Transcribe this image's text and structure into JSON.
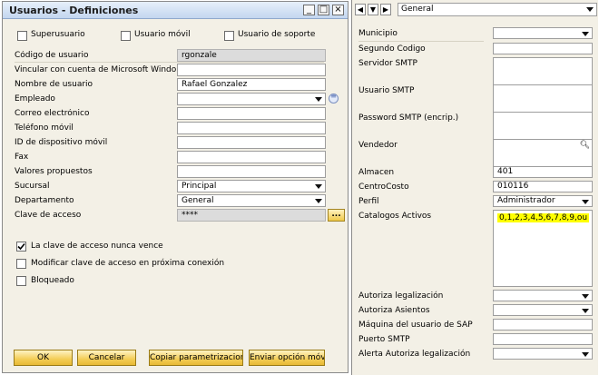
{
  "window": {
    "title": "Usuarios - Definiciones",
    "buttons": {
      "minimize": "_",
      "maximize": "□",
      "close": "×"
    }
  },
  "checkboxes_top": [
    {
      "label": "Superusuario",
      "checked": false
    },
    {
      "label": "Usuario móvil",
      "checked": false
    },
    {
      "label": "Usuario de soporte",
      "checked": false
    }
  ],
  "fields": [
    {
      "label": "Código de usuario",
      "value": "rgonzale",
      "readonly": true
    },
    {
      "label": "Vincular con cuenta de Microsoft Windo",
      "value": ""
    },
    {
      "label": "Nombre de usuario",
      "value": "Rafael Gonzalez"
    },
    {
      "label": "Empleado",
      "value": "",
      "dropdown": true
    },
    {
      "label": "Correo electrónico",
      "value": ""
    },
    {
      "label": "Teléfono móvil",
      "value": ""
    },
    {
      "label": "ID de dispositivo móvil",
      "value": ""
    },
    {
      "label": "Fax",
      "value": ""
    },
    {
      "label": "Valores propuestos",
      "value": ""
    },
    {
      "label": "Sucursal",
      "value": "Principal",
      "dropdown": true
    },
    {
      "label": "Departamento",
      "value": "General",
      "dropdown": true
    },
    {
      "label": "Clave de acceso",
      "value": "****",
      "readonly": true
    }
  ],
  "employee_link_icon": "circle-arrow-icon",
  "password_button": "...",
  "checkboxes_bottom": [
    {
      "label": "La clave de acceso nunca vence",
      "checked": true
    },
    {
      "label": "Modificar clave de acceso en próxima conexión",
      "checked": false
    },
    {
      "label": "Bloqueado",
      "checked": false
    }
  ],
  "buttons": [
    "OK",
    "Cancelar",
    "Copiar parametrizacion",
    "Enviar opción móvil"
  ],
  "right": {
    "nav": {
      "prev": "◀",
      "next": "▼",
      "last": "▶",
      "tab_value": "General"
    },
    "fields": [
      {
        "label": "Municipio",
        "value": "",
        "dropdown": true
      },
      {
        "label": "Segundo Codigo",
        "value": ""
      },
      {
        "label": "Servidor SMTP",
        "value": ""
      },
      {
        "label": "Usuario SMTP",
        "value": ""
      },
      {
        "label": "Password SMTP (encrip.)",
        "value": ""
      },
      {
        "label": "Vendedor",
        "value": "",
        "search": true
      },
      {
        "label": "Almacen",
        "value": "401"
      },
      {
        "label": "CentroCosto",
        "value": "010116"
      },
      {
        "label": "Perfil",
        "value": "Administrador",
        "dropdown": true
      },
      {
        "label": "Catalogos Activos",
        "value": "0,1,2,3,4,5,6,7,8,9,ou",
        "highlight": "#ffff00"
      },
      {
        "label": "Autoriza legalización",
        "value": "",
        "dropdown": true
      },
      {
        "label": "Autoriza Asientos",
        "value": "",
        "dropdown": true
      },
      {
        "label": "Máquina del usuario de SAP",
        "value": ""
      },
      {
        "label": "Puerto SMTP",
        "value": ""
      },
      {
        "label": "Alerta Autoriza legalización",
        "value": "",
        "dropdown": true
      }
    ],
    "search_icon": "magnifier-icon"
  },
  "colors": {
    "accent": "#f3cd55",
    "titlebar": "#c3d6ef",
    "highlight": "#ffff00",
    "panel": "#f3f0e6"
  }
}
